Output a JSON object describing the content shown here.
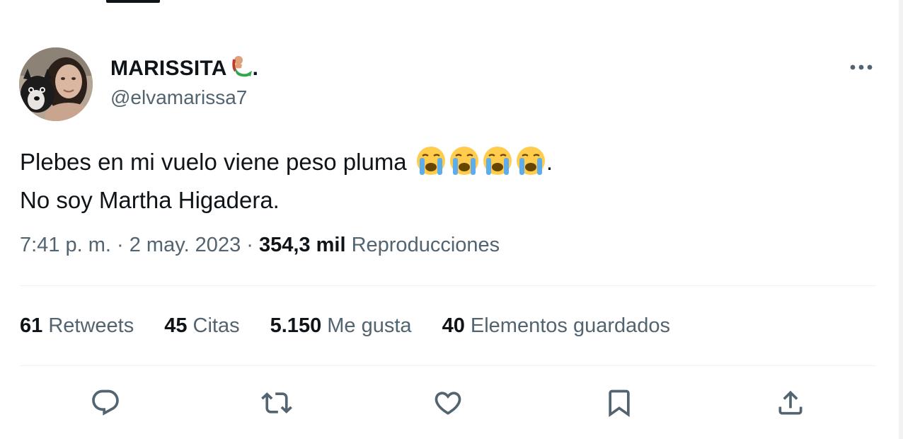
{
  "author": {
    "display_name": "MARISSITA",
    "name_suffix": ".",
    "handle": "@elvamarissa7"
  },
  "tweet": {
    "line1": "Plebes en mi vuelo viene peso pluma",
    "line1_end": ".",
    "line2": "No soy Martha Higadera."
  },
  "meta": {
    "time": "7:41 p. m.",
    "sep1": " · ",
    "date": "2 may. 2023",
    "sep2": " · ",
    "views": "354,3 mil",
    "views_label": "Reproducciones"
  },
  "stats": {
    "retweets_count": "61",
    "retweets_label": "Retweets",
    "quotes_count": "45",
    "quotes_label": "Citas",
    "likes_count": "5.150",
    "likes_label": "Me gusta",
    "bookmarks_count": "40",
    "bookmarks_label": "Elementos guardados"
  },
  "icons": {
    "more": "more-icon",
    "reply": "reply-icon",
    "retweet": "retweet-icon",
    "like": "heart-icon",
    "bookmark": "bookmark-icon",
    "share": "share-icon",
    "emoji": "loudly-crying-face-icon",
    "name_emoji": "mermaid-icon"
  },
  "colors": {
    "text": "#0f1419",
    "secondary": "#536471",
    "divider": "#eff3f4"
  }
}
